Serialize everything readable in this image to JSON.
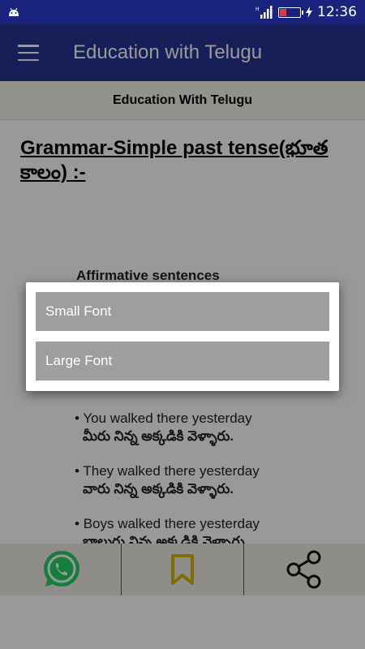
{
  "status_bar": {
    "time": "12:36"
  },
  "app_bar": {
    "title": "Education with Telugu"
  },
  "sub_header": {
    "title": "Education With Telugu"
  },
  "content": {
    "heading": "Grammar-Simple past tense(భూత కాలం)  :-",
    "section_title": "Affirmative sentences",
    "examples": [
      {
        "bullet": "•",
        "english": "You walked there yesterday",
        "telugu": "మీరు నిన్న అక్కడికి వెళ్ళారు."
      },
      {
        "bullet": "•",
        "english": "They walked there yesterday",
        "telugu": "వారు నిన్న అక్కడికి వెళ్ళారు."
      },
      {
        "bullet": "•",
        "english": "Boys walked there yesterday",
        "telugu": "బాలురు నిన్న అక్కడికి వెళ్ళారు."
      }
    ]
  },
  "dialog": {
    "options": [
      "Small Font",
      "Large Font"
    ]
  },
  "bottom_bar": {
    "icons": [
      "whatsapp-icon",
      "bookmark-icon",
      "share-icon"
    ]
  },
  "colors": {
    "status_bar": "#1a237e",
    "app_bar": "#283593",
    "whatsapp": "#25d366",
    "bookmark": "#d4b800"
  }
}
